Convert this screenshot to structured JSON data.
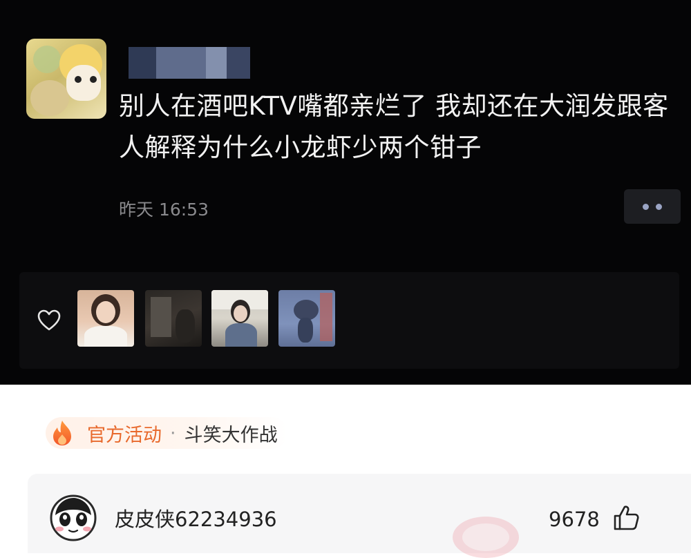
{
  "post": {
    "text": "别人在酒吧KTV嘴都亲烂了 我却还在大润发跟客人解释为什么小龙虾少两个钳子",
    "time": "昨天 16:53",
    "more_button_icon": "more-dots-icon",
    "likes": {
      "icon": "heart-icon",
      "avatar_count": 4
    }
  },
  "activity": {
    "icon": "fire-icon",
    "label": "官方活动",
    "separator": "·",
    "name": "斗笑大作战",
    "accent_color": "#e8692c"
  },
  "comment": {
    "username": "皮皮侠62234936",
    "like_count": "9678",
    "like_icon": "thumbs-up-icon"
  }
}
